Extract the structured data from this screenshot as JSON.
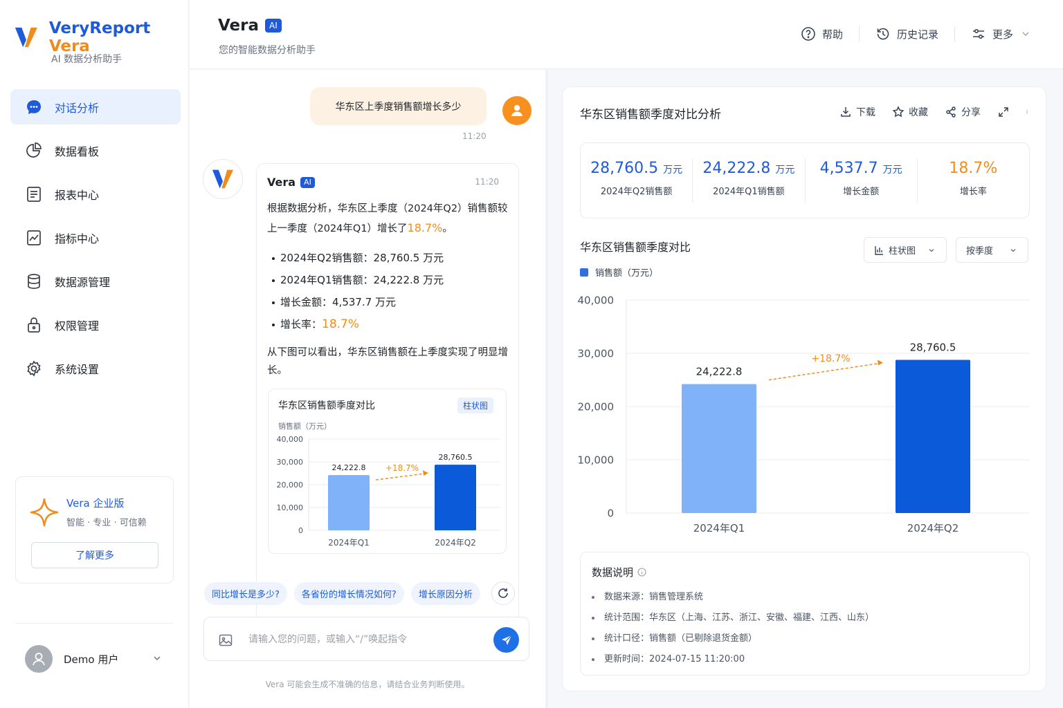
{
  "app": {
    "brand_a": "VeryReport",
    "brand_b": "Vera",
    "subtitle": "AI 数据分析助手"
  },
  "nav": [
    {
      "label": "对话分析",
      "icon": "chat-bubble-icon",
      "active": true
    },
    {
      "label": "数据看板",
      "icon": "pie-chart-icon"
    },
    {
      "label": "报表中心",
      "icon": "report-icon"
    },
    {
      "label": "指标中心",
      "icon": "metric-icon"
    },
    {
      "label": "数据源管理",
      "icon": "database-icon"
    },
    {
      "label": "权限管理",
      "icon": "lock-icon"
    },
    {
      "label": "系统设置",
      "icon": "gear-icon"
    }
  ],
  "promo": {
    "title": "Vera 企业版",
    "subtitle": "智能 · 专业 · 可信赖",
    "button": "了解更多"
  },
  "user": {
    "name": "Demo 用户"
  },
  "header": {
    "title": "Vera",
    "badge": "AI",
    "subtitle": "您的智能数据分析助手",
    "actions": [
      {
        "label": "帮助",
        "icon": "help-icon"
      },
      {
        "label": "历史记录",
        "icon": "history-icon"
      },
      {
        "label": "更多",
        "icon": "sliders-icon"
      }
    ]
  },
  "chat": {
    "user_message": "华东区上季度销售额增长多少",
    "user_time": "11:20",
    "bot_name": "Vera",
    "bot_badge": "AI",
    "bot_time": "11:20",
    "intro_text": "根据数据分析，华东区上季度（2024年Q2）销售额较上一季度（2024年Q1）增长了",
    "intro_value": "18.7%",
    "intro_end": "。",
    "bullets": [
      {
        "label": "2024年Q2销售额：",
        "value": "28,760.5 万元"
      },
      {
        "label": "2024年Q1销售额：",
        "value": "24,222.8 万元"
      },
      {
        "label": "增长金额：",
        "value": "4,537.7 万元"
      },
      {
        "label": "增长率：",
        "value": "18.7%"
      }
    ],
    "summary": "从下图可以看出，华东区销售额在上季度实现了明显增长。",
    "mini_chart": {
      "title": "华东区销售额季度对比",
      "tag": "柱状图",
      "unit": "销售额（万元）"
    },
    "suggestions": [
      "同比增长是多少?",
      "各省份的增长情况如何?",
      "增长原因分析"
    ],
    "input_placeholder": "请输入您的问题，或输入“/”唤起指令",
    "disclaimer": "Vera 可能会生成不准确的信息，请结合业务判断使用。"
  },
  "panel": {
    "title": "华东区销售额季度对比分析",
    "actions": [
      {
        "label": "下载",
        "icon": "download-icon"
      },
      {
        "label": "收藏",
        "icon": "star-icon"
      },
      {
        "label": "分享",
        "icon": "share-icon"
      }
    ],
    "kpis": [
      {
        "value": "28,760.5",
        "unit": "万元",
        "label": "2024年Q2销售额"
      },
      {
        "value": "24,222.8",
        "unit": "万元",
        "label": "2024年Q1销售额"
      },
      {
        "value": "4,537.7",
        "unit": "万元",
        "label": "增长金额"
      },
      {
        "value": "18.7%",
        "unit": "",
        "label": "增长率"
      }
    ],
    "chart_title": "华东区销售额季度对比",
    "chart_type_select": "柱状图",
    "period_select": "按季度",
    "legend": "销售额（万元）",
    "notes_title": "数据说明",
    "notes": [
      {
        "label": "数据来源：",
        "value": "销售管理系统"
      },
      {
        "label": "统计范围：",
        "value": "华东区（上海、江苏、浙江、安徽、福建、江西、山东）"
      },
      {
        "label": "统计口径：",
        "value": "销售额（已剔除退货金额）"
      },
      {
        "label": "更新时间：",
        "value": "2024-07-15 11:20:00"
      }
    ]
  },
  "colors": {
    "primary": "#1f5bd8",
    "accent": "#f08c1c",
    "bar_q1": "#7fb2f8",
    "bar_q2": "#0b5ad9"
  },
  "chart_data": [
    {
      "type": "bar",
      "title": "华东区销售额季度对比",
      "ylabel": "销售额（万元）",
      "categories": [
        "2024年Q1",
        "2024年Q2"
      ],
      "values": [
        24222.8,
        28760.5
      ],
      "value_labels": [
        "24,222.8",
        "28,760.5"
      ],
      "yticks": [
        "0",
        "10,000",
        "20,000",
        "30,000",
        "40,000"
      ],
      "ylim": [
        0,
        40000
      ],
      "annotation": "+18.7%",
      "grid": true
    },
    {
      "type": "bar",
      "title": "华东区销售额季度对比",
      "legend": "销售额（万元）",
      "categories": [
        "2024年Q1",
        "2024年Q2"
      ],
      "values": [
        24222.8,
        28760.5
      ],
      "value_labels": [
        "24,222.8",
        "28,760.5"
      ],
      "yticks": [
        "0",
        "10,000",
        "20,000",
        "30,000",
        "40,000"
      ],
      "ylim": [
        0,
        40000
      ],
      "annotation": "+18.7%",
      "grid": true,
      "legend_position": "top-left"
    }
  ]
}
